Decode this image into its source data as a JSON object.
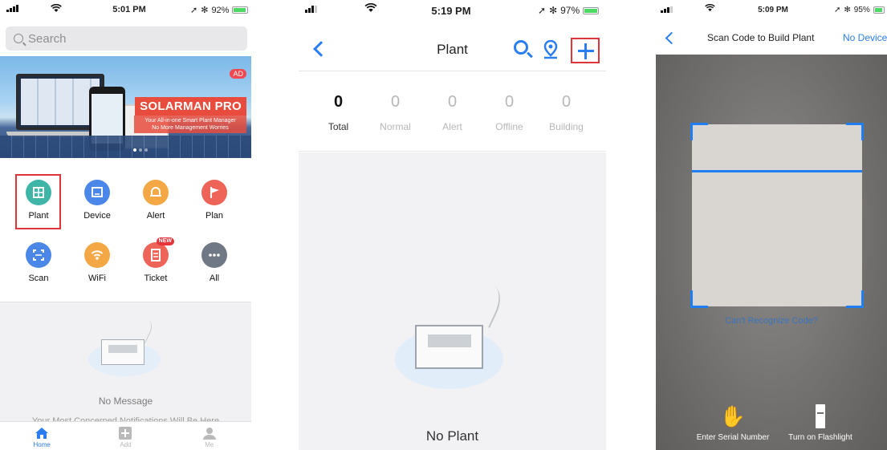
{
  "screen1": {
    "status": {
      "time": "5:01 PM",
      "battery": "92%"
    },
    "search": {
      "placeholder": "Search"
    },
    "banner": {
      "ad": "AD",
      "brand": "SOLARMAN PRO",
      "tagline1": "Your All-in-one Smart Plant Manager",
      "tagline2": "No More Management Worries"
    },
    "features": [
      {
        "label": "Plant",
        "icon": "plant-icon",
        "color": "#3fb5a8"
      },
      {
        "label": "Device",
        "icon": "device-icon",
        "color": "#4b87e8"
      },
      {
        "label": "Alert",
        "icon": "bell-icon",
        "color": "#f3a845"
      },
      {
        "label": "Plan",
        "icon": "flag-icon",
        "color": "#ee6458"
      },
      {
        "label": "Scan",
        "icon": "scan-icon",
        "color": "#4b87e8"
      },
      {
        "label": "WiFi",
        "icon": "wifi-icon",
        "color": "#f3a845"
      },
      {
        "label": "Ticket",
        "icon": "ticket-icon",
        "color": "#ee6458",
        "badge": "NEW"
      },
      {
        "label": "All",
        "icon": "more-icon",
        "color": "#707885"
      }
    ],
    "message": {
      "title": "No Message",
      "subtitle": "Your Most Concerned Notifications Will Be Here"
    },
    "tabs": [
      {
        "label": "Home",
        "color": "#2a7ef2"
      },
      {
        "label": "Add",
        "color": "#b9b9b9"
      },
      {
        "label": "Me",
        "color": "#b9b9b9"
      }
    ]
  },
  "screen2": {
    "status": {
      "time": "5:19 PM",
      "battery": "97%"
    },
    "title": "Plant",
    "stats": [
      {
        "num": "0",
        "label": "Total"
      },
      {
        "num": "0",
        "label": "Normal"
      },
      {
        "num": "0",
        "label": "Alert"
      },
      {
        "num": "0",
        "label": "Offline"
      },
      {
        "num": "0",
        "label": "Building"
      }
    ],
    "empty": "No Plant"
  },
  "screen3": {
    "status": {
      "time": "5:09 PM",
      "battery": "95%"
    },
    "title": "Scan Code to Build Plant",
    "no_device": "No Device",
    "cant_recognize": "Can't Recognize Code?",
    "enter_serial": "Enter Serial Number",
    "flashlight": "Turn on Flashlight"
  },
  "colors": {
    "accent": "#2a7ef2",
    "highlight": "#e0343b"
  }
}
